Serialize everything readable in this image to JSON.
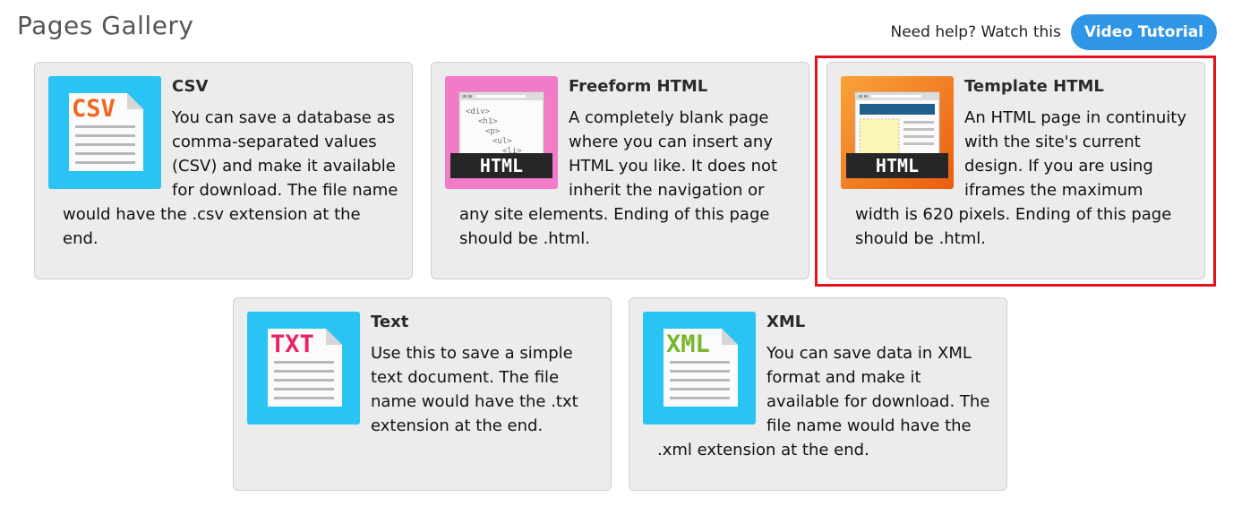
{
  "header": {
    "title": "Pages Gallery",
    "help_text": "Need help? Watch this",
    "video_button": "Video Tutorial"
  },
  "colors": {
    "accent_button": "#2f95e6",
    "highlight_border": "#e4121c",
    "card_bg": "#ececec",
    "thumb_blue": "#29c4f3",
    "thumb_pink": "#f27bc7",
    "thumb_orange": "#f07a1e"
  },
  "cards": [
    {
      "title": "CSV",
      "icon": "csv-file-icon",
      "icon_label": "CSV",
      "description": "You can save a database as comma-separated values (CSV) and make it available for download. The file name would have the .csv extension at the end."
    },
    {
      "title": "Freeform HTML",
      "icon": "freeform-html-icon",
      "icon_label": "HTML",
      "code_lines": [
        "<div>",
        "<h1>",
        "<p>",
        "<ul>",
        "<li>"
      ],
      "description": "A completely blank page where you can insert any HTML you like. It does not inherit the navigation or any site elements. Ending of this page should be .html."
    },
    {
      "title": "Template HTML",
      "icon": "template-html-icon",
      "icon_label": "HTML",
      "selected": true,
      "description": "An HTML page in continuity with the site's current design. If you are using iframes the maximum width is 620 pixels. Ending of this page should be .html."
    },
    {
      "title": "Text",
      "icon": "txt-file-icon",
      "icon_label": "TXT",
      "description": "Use this to save a simple text document. The file name would have the .txt extension at the end."
    },
    {
      "title": "XML",
      "icon": "xml-file-icon",
      "icon_label": "XML",
      "description": "You can save data in XML format and make it available for download. The file name would have the .xml extension at the end."
    }
  ]
}
